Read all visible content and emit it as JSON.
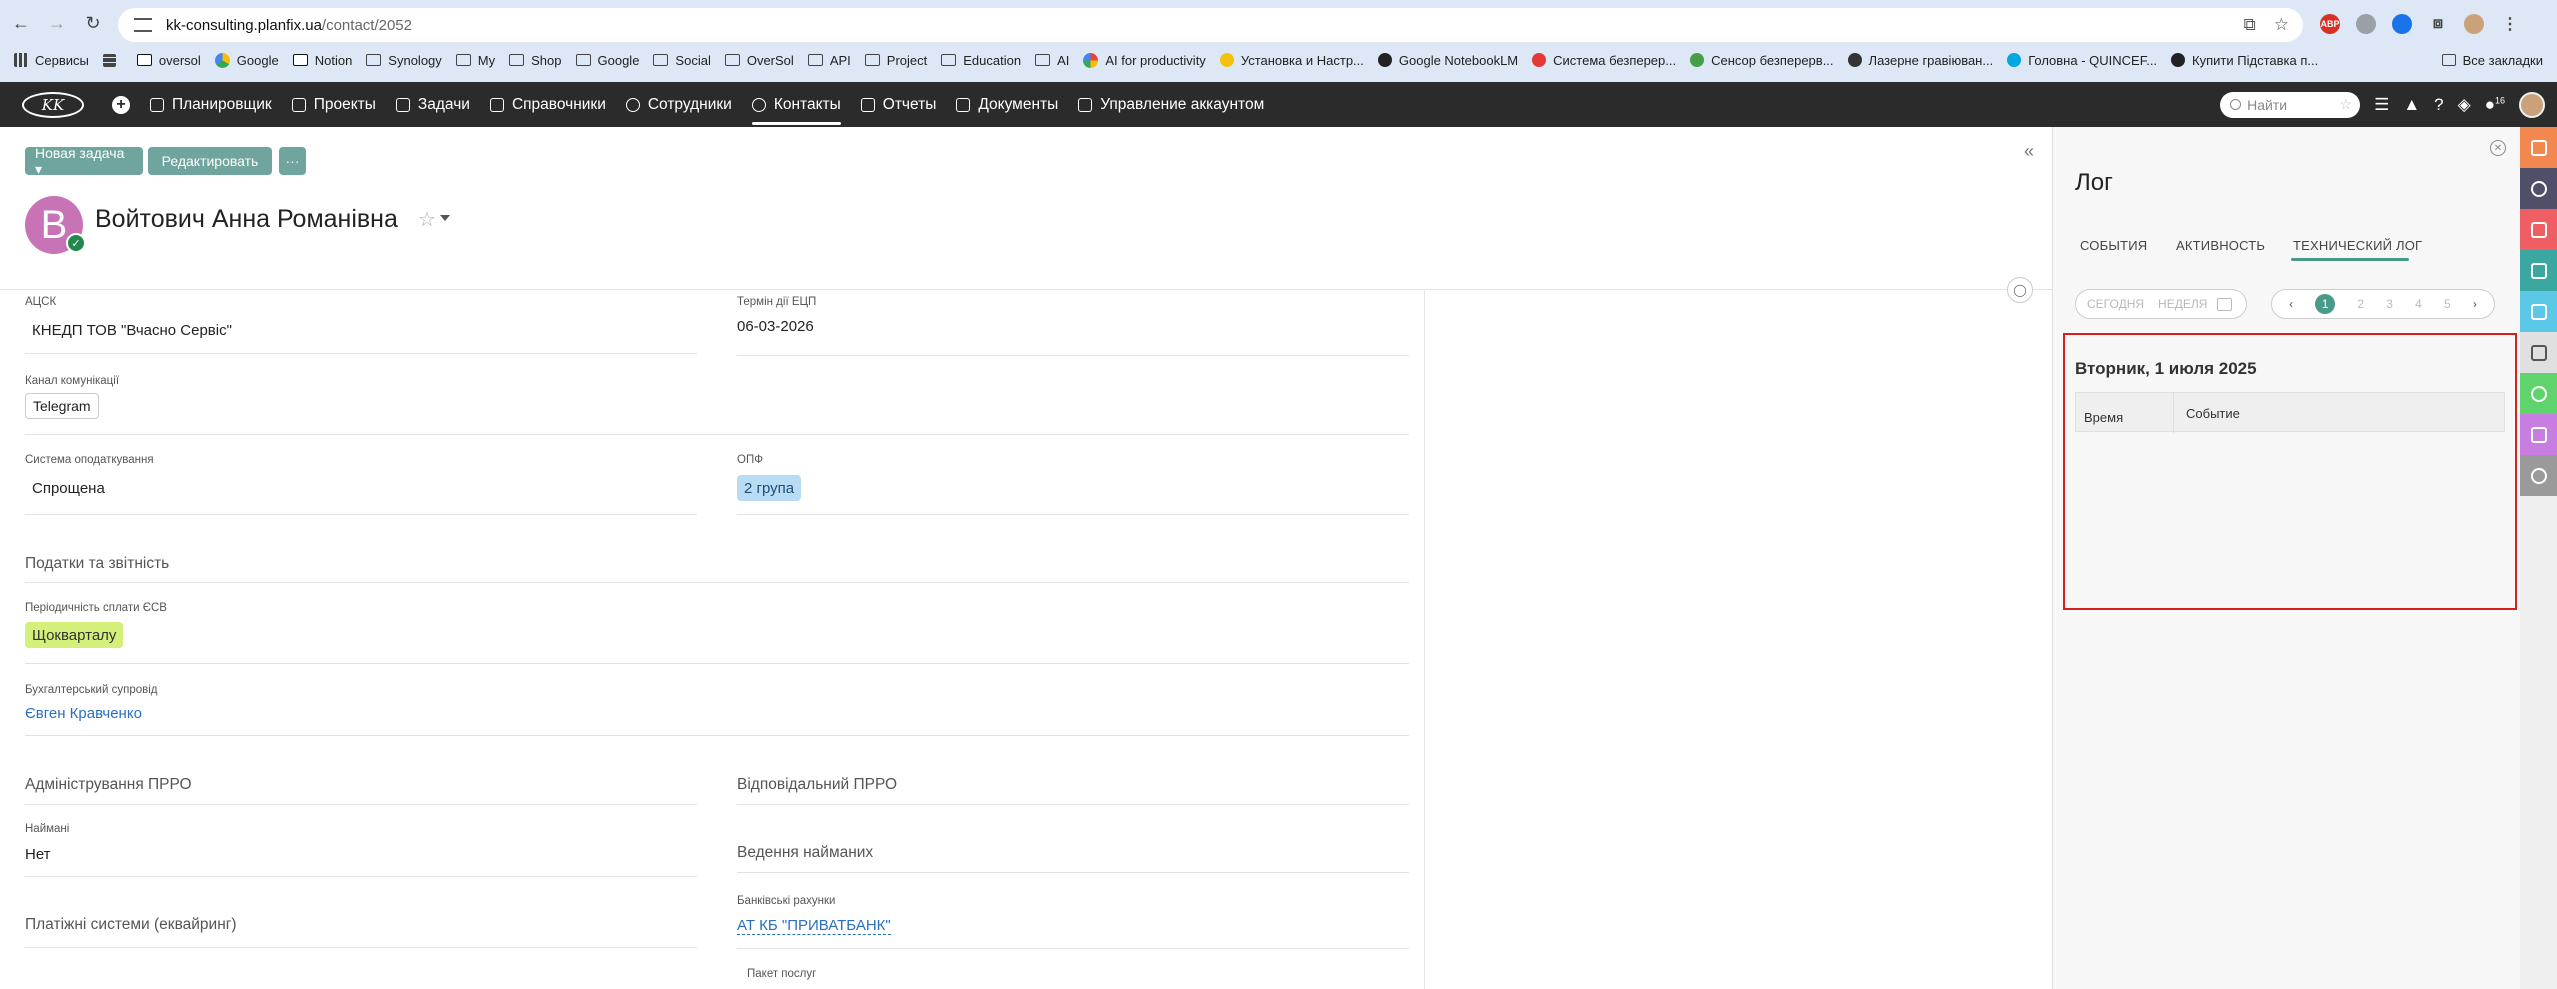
{
  "browser": {
    "url_host": "kk-consulting.planfix.ua",
    "url_path": "/contact/2052",
    "bookmarks": [
      "Сервисы",
      "oversol",
      "Google",
      "Notion",
      "Synology",
      "My",
      "Shop",
      "Google",
      "Social",
      "OverSol",
      "API",
      "Project",
      "Education",
      "AI",
      "AI for productivity",
      "Установка и Настр...",
      "Google NotebookLM",
      "Система безперер...",
      "Сенсор безперерв...",
      "Лазерне гравіюван...",
      "Головна - QUINCEF...",
      "Купити Підставка п..."
    ],
    "all_bookmarks": "Все закладки"
  },
  "app": {
    "logo": "KK",
    "menu": [
      "Планировщик",
      "Проекты",
      "Задачи",
      "Справочники",
      "Сотрудники",
      "Контакты",
      "Отчеты",
      "Документы",
      "Управление аккаунтом"
    ],
    "active_menu": "Контакты",
    "search_placeholder": "Найти",
    "notification_count": "16"
  },
  "toolbar": {
    "new_task": "Новая задача ▾",
    "edit": "Редактировать",
    "more": "···"
  },
  "contact": {
    "avatar_letter": "В",
    "name": "Войтович Анна Романівна"
  },
  "fields": {
    "acsk_label": "АЦСК",
    "acsk_value": "КНЕДП ТОВ \"Вчасно Сервіс\"",
    "ecp_label": "Термін дії ЕЦП",
    "ecp_value": "06-03-2026",
    "channel_label": "Канал комунікації",
    "channel_value": "Telegram",
    "tax_label": "Система оподаткування",
    "tax_value": "Спрощена",
    "opf_label": "ОПФ",
    "opf_value": "2 група",
    "section_taxes": "Податки та звітність",
    "esv_label": "Періодичність сплати ЄСВ",
    "esv_value": "Щокварталу",
    "accountant_label": "Бухгалтерський супровід",
    "accountant_value": "Євген Кравченко",
    "section_prro": "Адміністрування ПРРО",
    "section_prro_resp": "Відповідальний ПРРО",
    "hired_label": "Наймані",
    "hired_value": "Нет",
    "section_hiring": "Ведення найманих",
    "bank_label": "Банківські рахунки",
    "bank_value": "АТ КБ \"ПРИВАТБАНК\"",
    "section_payment": "Платіжні системи (еквайринг)",
    "package_label": "Пакет послуг"
  },
  "log_panel": {
    "title": "Лог",
    "tabs": [
      "СОБЫТИЯ",
      "АКТИВНОСТЬ",
      "ТЕХНИЧЕСКИЙ ЛОГ"
    ],
    "active_tab": "ТЕХНИЧЕСКИЙ ЛОГ",
    "period_today": "СЕГОДНЯ",
    "period_week": "НЕДЕЛЯ",
    "pages": [
      "1",
      "2",
      "3",
      "4",
      "5"
    ],
    "current_page": "1",
    "date_heading": "Вторник, 1 июля 2025",
    "col_time": "Время",
    "col_event": "Событие"
  },
  "colors": {
    "app_bar": "#2b2b2b",
    "accent": "#6fa59d",
    "highlight_border": "#d6201e",
    "tag_opf": "#b8dcf4",
    "tag_esv": "#d4f07a",
    "sidebar_icons": [
      "#f2884f",
      "#4f4f6a",
      "#ee5e63",
      "#3aa8a0",
      "#5bc8e8",
      "#e0e0e0",
      "#5fd36c",
      "#c87de0",
      "#9a9a9a"
    ]
  }
}
